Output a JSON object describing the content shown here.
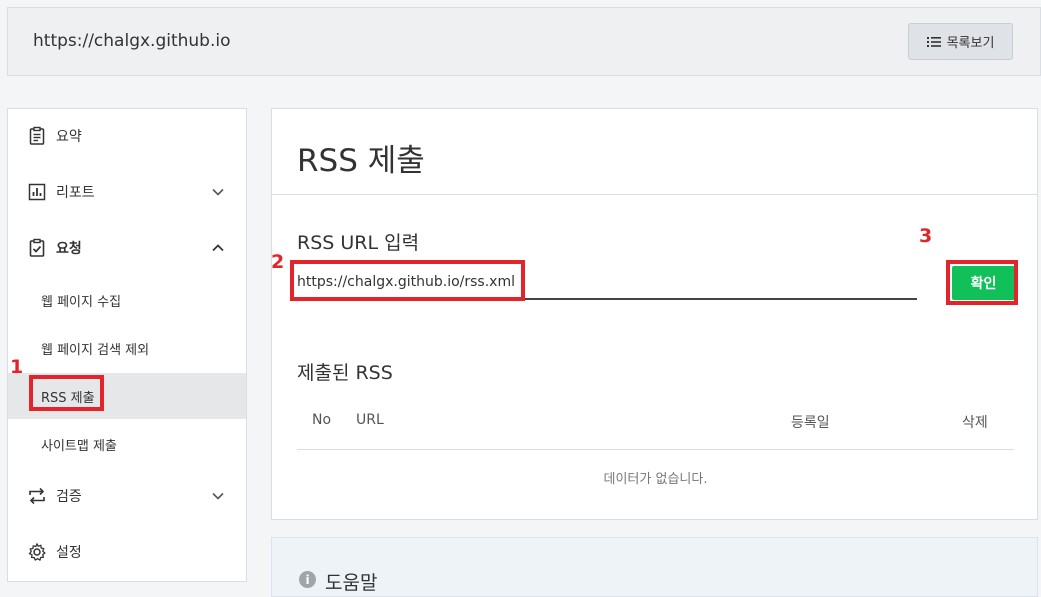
{
  "header": {
    "site_url": "https://chalgx.github.io",
    "list_button_label": "목록보기"
  },
  "sidebar": {
    "items": [
      {
        "label": "요약",
        "icon": "clipboard-icon"
      },
      {
        "label": "리포트",
        "icon": "bar-chart-icon"
      },
      {
        "label": "요청",
        "icon": "clipboard-check-icon"
      },
      {
        "label": "검증",
        "icon": "repeat-icon"
      },
      {
        "label": "설정",
        "icon": "gear-icon"
      }
    ],
    "sub_items": [
      {
        "label": "웹 페이지 수집"
      },
      {
        "label": "웹 페이지 검색 제외"
      },
      {
        "label": "RSS 제출"
      },
      {
        "label": "사이트맵 제출"
      }
    ]
  },
  "main": {
    "title": "RSS 제출",
    "input_section_label": "RSS URL 입력",
    "url_value": "https://chalgx.github.io/rss.xml",
    "confirm_label": "확인",
    "submitted_label": "제출된 RSS",
    "columns": [
      "No",
      "URL",
      "등록일",
      "삭제"
    ],
    "empty_message": "데이터가 없습니다."
  },
  "help": {
    "icon_glyph": "i",
    "title": "도움말"
  },
  "annotations": [
    "1",
    "2",
    "3"
  ],
  "colors": {
    "accent_green": "#12c05a",
    "annotation_red": "#e3242b",
    "active_bg": "#e6e7e9"
  }
}
